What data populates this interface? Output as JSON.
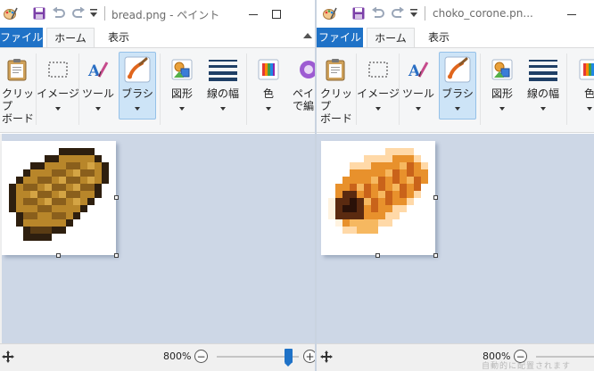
{
  "left": {
    "title": "bread.png - ペイント",
    "tabs": [
      "ファイル",
      "ホーム",
      "表示"
    ],
    "ribbon": {
      "clipboard": "クリップ\nボード",
      "image": "イメージ",
      "tools": "ツール",
      "brush": "ブラシ",
      "shapes": "図形",
      "size": "線の幅",
      "colors": "色",
      "paint3d": "ペイン\nで編"
    },
    "zoom": "800%"
  },
  "right": {
    "title": "choko_corone.pn...",
    "tabs": [
      "ファイル",
      "ホーム",
      "表示"
    ],
    "ribbon": {
      "clipboard": "クリップ\nボード",
      "image": "イメージ",
      "tools": "ツール",
      "brush": "ブラシ",
      "shapes": "図形",
      "size": "線の幅",
      "colors": "色"
    },
    "zoom": "800%",
    "faint_text": "自動的に配置されます"
  },
  "icons": {
    "app": "paint-app-icon",
    "save": "save-icon",
    "undo": "undo-icon",
    "redo": "redo-icon",
    "customize": "customize-arrow-icon"
  },
  "colors": {
    "accent": "#1f72c7",
    "workspace": "#cdd7e6",
    "ribbon": "#f5f6f7",
    "brush_active": "#cde4f7",
    "bread_base": "#b8862a",
    "cornet_base": "#e8912c"
  }
}
